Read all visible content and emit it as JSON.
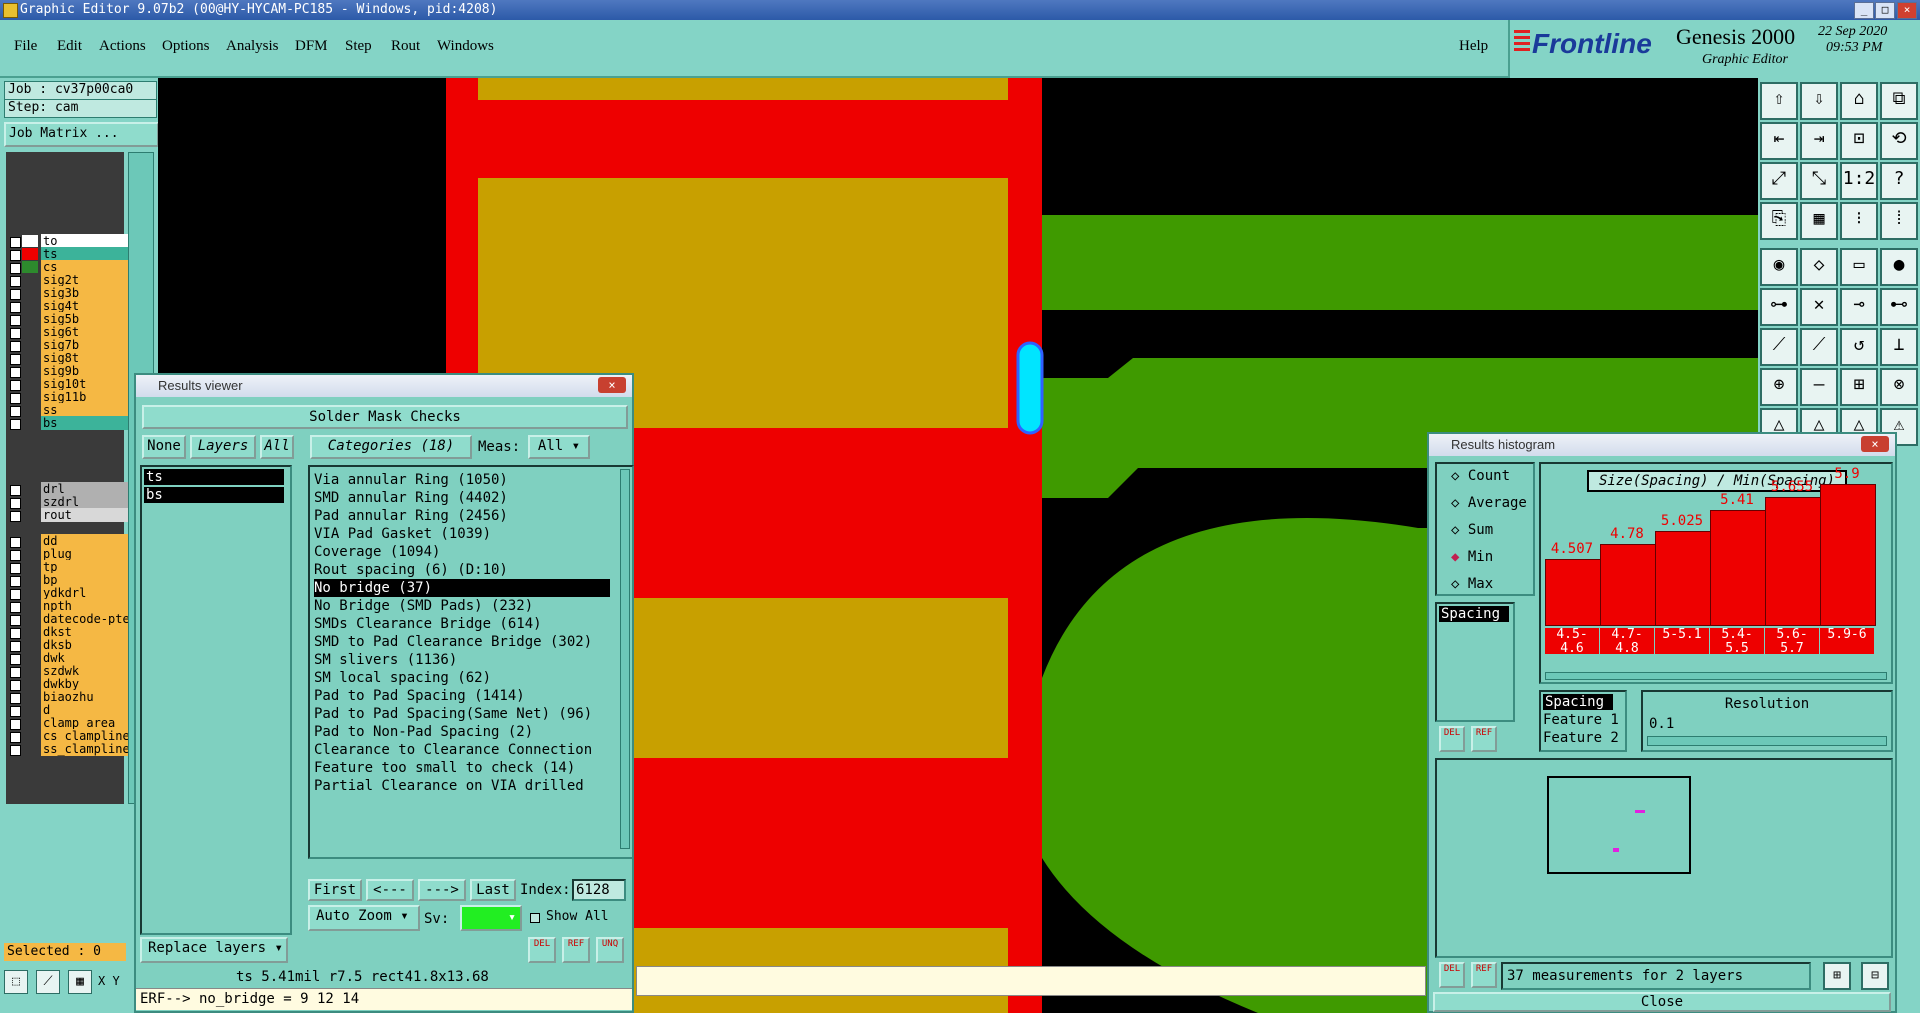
{
  "window": {
    "title": "Graphic Editor 9.07b2 (00@HY-HYCAM-PC185 - Windows, pid:4208)"
  },
  "menu": {
    "items": [
      "File",
      "Edit",
      "Actions",
      "Options",
      "Analysis",
      "DFM",
      "Step",
      "Rout",
      "Windows"
    ],
    "help": "Help"
  },
  "brand": {
    "logo": "Frontline",
    "product": "Genesis 2000",
    "subtitle": "Graphic Editor",
    "date": "22 Sep 2020",
    "time": "09:53 PM"
  },
  "job": {
    "job_label": "Job : cv37p00ca0",
    "step_label": "Step: cam",
    "matrix_button": "Job Matrix ..."
  },
  "layers": {
    "group1": [
      {
        "name": "to",
        "color": "#ffffff",
        "swatch": "#ffffff"
      },
      {
        "name": "ts",
        "color": "#3cb39a",
        "swatch": "#ee0000"
      },
      {
        "name": "cs",
        "color": "#f5b844",
        "swatch": "#2d8a2d"
      },
      {
        "name": "sig2t",
        "color": "#f5b844",
        "swatch": ""
      },
      {
        "name": "sig3b",
        "color": "#f5b844",
        "swatch": ""
      },
      {
        "name": "sig4t",
        "color": "#f5b844",
        "swatch": ""
      },
      {
        "name": "sig5b",
        "color": "#f5b844",
        "swatch": ""
      },
      {
        "name": "sig6t",
        "color": "#f5b844",
        "swatch": ""
      },
      {
        "name": "sig7b",
        "color": "#f5b844",
        "swatch": ""
      },
      {
        "name": "sig8t",
        "color": "#f5b844",
        "swatch": ""
      },
      {
        "name": "sig9b",
        "color": "#f5b844",
        "swatch": ""
      },
      {
        "name": "sig10t",
        "color": "#f5b844",
        "swatch": ""
      },
      {
        "name": "sig11b",
        "color": "#f5b844",
        "swatch": ""
      },
      {
        "name": "ss",
        "color": "#f5b844",
        "swatch": ""
      },
      {
        "name": "bs",
        "color": "#3cb39a",
        "swatch": ""
      }
    ],
    "group2": [
      {
        "name": "drl",
        "color": "#b0b0b0"
      },
      {
        "name": "szdrl",
        "color": "#b0b0b0"
      },
      {
        "name": "rout",
        "color": "#d8d8d8"
      }
    ],
    "group3": [
      "dd",
      "plug",
      "tp",
      "bp",
      "ydkdrl",
      "npth",
      "datecode-pte",
      "dkst",
      "dksb",
      "dwk",
      "szdwk",
      "dwkby",
      "biaozhu",
      "d",
      "clamp_area",
      "cs_clampline",
      "ss_clampline"
    ]
  },
  "selected_label": "Selected : 0",
  "xy_label": "X Y",
  "results_viewer": {
    "title": "Results viewer",
    "header": "Solder Mask Checks",
    "none_btn": "None",
    "layers_btn": "Layers",
    "all_btn": "All",
    "categories_btn": "Categories (18)",
    "meas_label": "Meas:",
    "meas_value": "All",
    "layer_list": [
      "ts",
      "bs"
    ],
    "categories": [
      "Via annular Ring (1050)",
      "SMD annular Ring (4402)",
      "Pad annular Ring (2456)",
      "VIA Pad Gasket (1039)",
      "Coverage (1094)",
      "Rout spacing (6)               (D:10)",
      "No bridge (37)",
      "No Bridge (SMD Pads) (232)",
      "SMDs Clearance Bridge (614)",
      "SMD to Pad Clearance Bridge (302)",
      "SM slivers (1136)",
      "SM local spacing (62)",
      "Pad to Pad Spacing (1414)",
      "Pad to Pad Spacing(Same Net) (96)",
      "Pad to Non-Pad Spacing (2)",
      "Clearance to Clearance Connection",
      "Feature too small to check (14)",
      "Partial Clearance on VIA drilled"
    ],
    "selected_index": 6,
    "first_btn": "First",
    "prev_btn": "<---",
    "next_btn": "--->",
    "last_btn": "Last",
    "index_label": "Index:",
    "index_value": "6128",
    "autozoom_btn": "Auto Zoom",
    "sv_label": "Sv:",
    "show_all_label": "Show All",
    "replace_layers_btn": "Replace layers",
    "del_btn": "DEL",
    "ref_btn": "REF",
    "unq_btn": "UNQ"
  },
  "status": {
    "feature_line": "ts 5.41mil   r7.5   rect41.8x13.68",
    "erf_line": "ERF--> no_bridge = 9 12 14"
  },
  "results_histogram": {
    "title": "Results histogram",
    "radios": [
      "Count",
      "Average",
      "Sum",
      "Min",
      "Max"
    ],
    "selected_radio": "Min",
    "chart_title": "Size(Spacing) / Min(Spacing)",
    "measure_list": [
      "Spacing"
    ],
    "field_list": [
      "Spacing",
      "Feature 1",
      "Feature 2"
    ],
    "resolution_label": "Resolution",
    "resolution_value": "0.1",
    "footer": "37 measurements for 2 layers",
    "close_btn": "Close",
    "del_btn": "DEL",
    "ref_btn": "REF"
  },
  "chart_data": {
    "type": "bar",
    "title": "Size(Spacing) / Min(Spacing)",
    "categories": [
      "4.5-4.6",
      "4.7-4.8",
      "5-5.1",
      "5.4-5.5",
      "5.6-5.7",
      "5.9-6"
    ],
    "values": [
      4.507,
      4.78,
      5.025,
      5.41,
      5.655,
      5.9
    ],
    "ylim": [
      0,
      6.2
    ]
  },
  "colors": {
    "ui_bg": "#84d4c6",
    "solder_mask": "#ee0000",
    "copper": "#c8a000",
    "green_layer": "#3f9a00",
    "highlight": "#00e5ff"
  }
}
